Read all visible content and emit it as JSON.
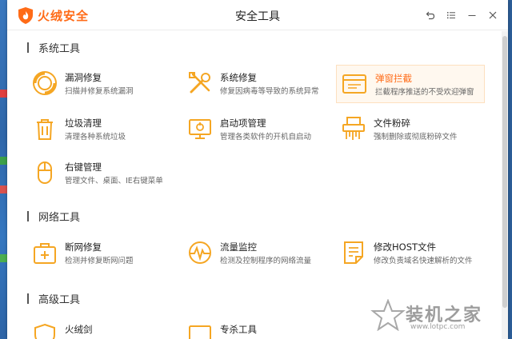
{
  "brand": {
    "name": "火绒安全"
  },
  "window": {
    "title": "安全工具"
  },
  "controls": [
    {
      "name": "back-icon"
    },
    {
      "name": "menu-icon"
    },
    {
      "name": "minimize-icon"
    },
    {
      "name": "close-icon"
    }
  ],
  "sections": {
    "system": {
      "label": "系统工具",
      "tools": [
        {
          "name": "漏洞修复",
          "desc": "扫描并修复系统漏洞",
          "icon": "shield-scan-icon"
        },
        {
          "name": "系统修复",
          "desc": "修复因病毒等导致的系统异常",
          "icon": "wrench-icon"
        },
        {
          "name": "弹窗拦截",
          "desc": "拦截程序推送的不受欢迎弹窗",
          "icon": "popup-window-icon"
        },
        {
          "name": "垃圾清理",
          "desc": "清理各种系统垃圾",
          "icon": "trash-icon"
        },
        {
          "name": "启动项管理",
          "desc": "管理各类软件的开机自启动",
          "icon": "monitor-startup-icon"
        },
        {
          "name": "文件粉碎",
          "desc": "强制删除或彻底粉碎文件",
          "icon": "shredder-icon"
        },
        {
          "name": "右键管理",
          "desc": "管理文件、桌面、IE右键菜单",
          "icon": "mouse-icon"
        }
      ]
    },
    "network": {
      "label": "网络工具",
      "tools": [
        {
          "name": "断网修复",
          "desc": "检测并修复断网问题",
          "icon": "first-aid-icon"
        },
        {
          "name": "流量监控",
          "desc": "检测及控制程序的网络流量",
          "icon": "traffic-monitor-icon"
        },
        {
          "name": "修改HOST文件",
          "desc": "修改负责域名快速解析的文件",
          "icon": "host-file-icon"
        }
      ]
    },
    "advanced": {
      "label": "高级工具",
      "tools": [
        {
          "name": "火绒剑",
          "icon": "shield-icon"
        },
        {
          "name": "专杀工具",
          "icon": "monitor-icon"
        }
      ]
    }
  },
  "watermark": {
    "text": "装机之家",
    "url": "www.lotpc.com"
  },
  "colors": {
    "accent": "#ff6b17",
    "icon": "#f5a623",
    "active_bg": "#fff8ef"
  }
}
